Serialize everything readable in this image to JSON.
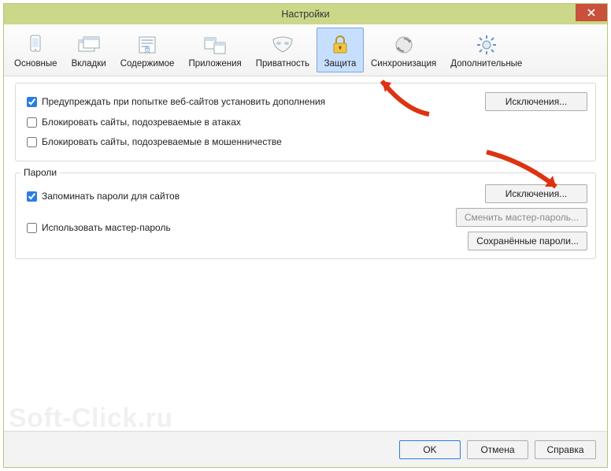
{
  "window": {
    "title": "Настройки"
  },
  "tabs": [
    {
      "label": "Основные"
    },
    {
      "label": "Вкладки"
    },
    {
      "label": "Содержимое"
    },
    {
      "label": "Приложения"
    },
    {
      "label": "Приватность"
    },
    {
      "label": "Защита"
    },
    {
      "label": "Синхронизация"
    },
    {
      "label": "Дополнительные"
    }
  ],
  "section_addons": {
    "chk_warn": {
      "label": "Предупреждать при попытке веб-сайтов установить дополнения",
      "checked": true
    },
    "chk_block_attack": {
      "label": "Блокировать сайты, подозреваемые в атаках",
      "checked": false
    },
    "chk_block_fraud": {
      "label": "Блокировать сайты, подозреваемые в мошенничестве",
      "checked": false
    },
    "btn_exceptions": "Исключения..."
  },
  "section_passwords": {
    "legend": "Пароли",
    "chk_remember": {
      "label": "Запоминать пароли для сайтов",
      "checked": true
    },
    "chk_master": {
      "label": "Использовать мастер-пароль",
      "checked": false
    },
    "btn_exceptions": "Исключения...",
    "btn_change_master": "Сменить мастер-пароль...",
    "btn_saved": "Сохранённые пароли..."
  },
  "footer": {
    "ok": "OK",
    "cancel": "Отмена",
    "help": "Справка"
  },
  "watermark": "Soft-Click.ru"
}
